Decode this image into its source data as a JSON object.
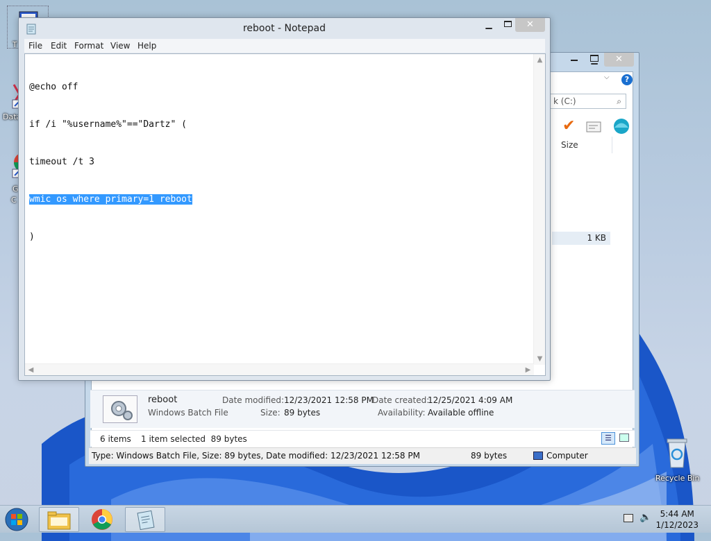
{
  "desktop": {
    "icons": [
      {
        "label": "T"
      },
      {
        "label": "Data"
      },
      {
        "label": "G"
      },
      {
        "label": "C"
      },
      {
        "label": "Recycle Bin"
      }
    ]
  },
  "explorer": {
    "search_placeholder": "k (C:)",
    "column_size": "Size",
    "row_size": "1 KB",
    "details": {
      "name": "reboot",
      "type": "Windows Batch File",
      "date_modified_label": "Date modified:",
      "date_modified": "12/23/2021 12:58 PM",
      "size_label": "Size:",
      "size": "89 bytes",
      "date_created_label": "Date created:",
      "date_created": "12/25/2021 4:09 AM",
      "availability_label": "Availability:",
      "availability": "Available offline"
    },
    "status": {
      "items": "6 items",
      "selected": "1 item selected  89 bytes",
      "info": "Type: Windows Batch File, Size: 89 bytes, Date modified: 12/23/2021 12:58 PM",
      "size": "89 bytes",
      "location": "Computer"
    }
  },
  "notepad": {
    "title": "reboot - Notepad",
    "menu": [
      "File",
      "Edit",
      "Format",
      "View",
      "Help"
    ],
    "lines": [
      "@echo off",
      "if /i \"%username%\"==\"Dartz\" (",
      "timeout /t 3",
      "wmic os where primary=1 reboot",
      ")"
    ],
    "selected_line": 3
  },
  "taskbar": {
    "time": "5:44 AM",
    "date": "1/12/2023"
  },
  "colors": {
    "selection": "#3399ff",
    "close_button": "#c7c7c7",
    "taskbar": "#b5c6d6"
  }
}
